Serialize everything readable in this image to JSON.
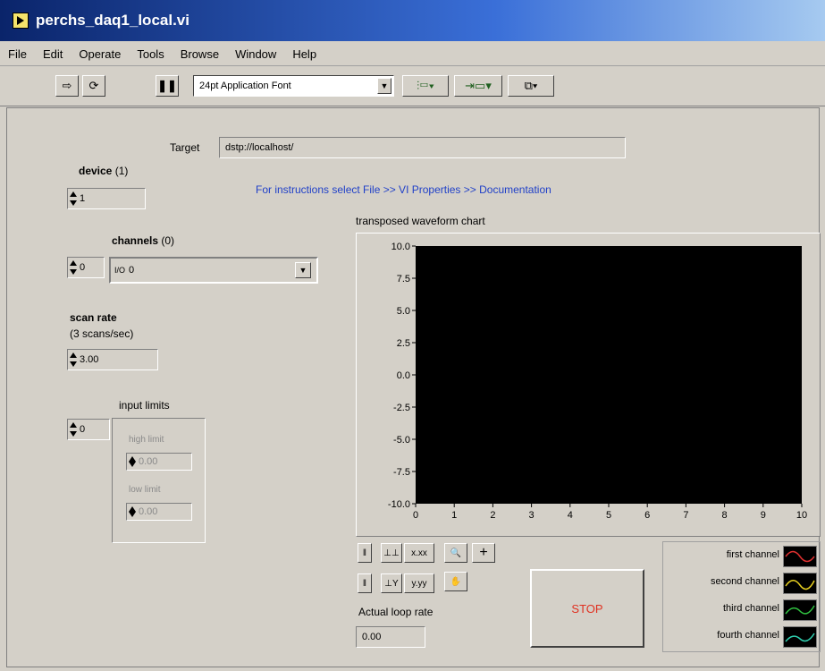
{
  "window": {
    "title": "perchs_daq1_local.vi"
  },
  "menu": [
    "File",
    "Edit",
    "Operate",
    "Tools",
    "Browse",
    "Window",
    "Help"
  ],
  "toolbar": {
    "font": "24pt Application Font",
    "run_icon": "run-arrow-icon",
    "continuous_icon": "continuous-run-icon",
    "pause_icon": "pause-icon"
  },
  "panel": {
    "target_label": "Target",
    "target_value": "dstp://localhost/",
    "instructions": "For instructions select File >> VI Properties >> Documentation",
    "device": {
      "label": "device",
      "suffix": "(1)",
      "value": "1"
    },
    "channels": {
      "label": "channels",
      "suffix": "(0)",
      "index": "0",
      "value": "0"
    },
    "scan_rate": {
      "label": "scan rate",
      "sublabel": "(3 scans/sec)",
      "value": "3.00"
    },
    "input_limits": {
      "label": "input limits",
      "index": "0",
      "high_label": "high limit",
      "high_value": "0.00",
      "low_label": "low limit",
      "low_value": "0.00"
    },
    "loop_rate": {
      "label": "Actual loop rate",
      "value": "0.00"
    },
    "stop_label": "STOP"
  },
  "chart_data": {
    "type": "line",
    "title": "transposed waveform chart",
    "xlabel": "",
    "ylabel": "",
    "xlim": [
      0,
      10
    ],
    "ylim": [
      -10,
      10
    ],
    "xticks": [
      "0",
      "1",
      "2",
      "3",
      "4",
      "5",
      "6",
      "7",
      "8",
      "9",
      "10"
    ],
    "yticks": [
      "10.0",
      "7.5",
      "5.0",
      "2.5",
      "0.0",
      "-2.5",
      "-5.0",
      "-7.5",
      "-10.0"
    ],
    "background": "#000000",
    "series": [
      {
        "name": "first channel",
        "color": "#e03030",
        "values": []
      },
      {
        "name": "second channel",
        "color": "#e8d020",
        "values": []
      },
      {
        "name": "third channel",
        "color": "#30c040",
        "values": []
      },
      {
        "name": "fourth channel",
        "color": "#30d0b0",
        "values": []
      }
    ]
  }
}
